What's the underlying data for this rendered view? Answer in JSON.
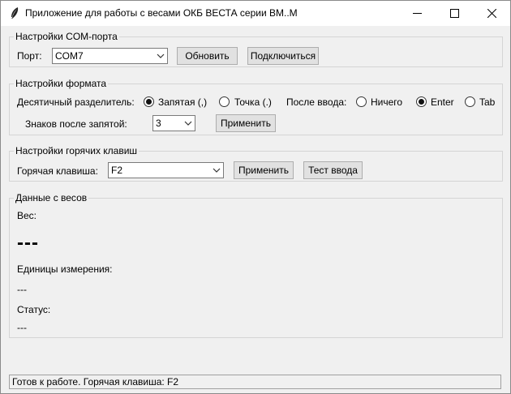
{
  "window": {
    "title": "Приложение для работы с весами ОКБ ВЕСТА серии ВМ..М",
    "icon": "feather-icon"
  },
  "com_settings": {
    "group_title": "Настройки COM-порта",
    "port_label": "Порт:",
    "port_value": "COM7",
    "refresh_label": "Обновить",
    "connect_label": "Подключиться"
  },
  "format_settings": {
    "group_title": "Настройки формата",
    "decimal_label": "Десятичный разделитель:",
    "comma_option": "Запятая (,)",
    "dot_option": "Точка (.)",
    "decimal_selected": "comma",
    "after_input_label": "После ввода:",
    "nothing_option": "Ничего",
    "enter_option": "Enter",
    "tab_option": "Tab",
    "after_input_selected": "enter",
    "digits_label": "Знаков после запятой:",
    "digits_value": "3",
    "apply_label": "Применить"
  },
  "hotkey_settings": {
    "group_title": "Настройки горячих клавиш",
    "hotkey_label": "Горячая клавиша:",
    "hotkey_value": "F2",
    "apply_label": "Применить",
    "test_label": "Тест ввода"
  },
  "scale_data": {
    "group_title": "Данные с весов",
    "weight_label": "Вес:",
    "weight_value": "---",
    "units_label": "Единицы измерения:",
    "units_value": "---",
    "status_label": "Статус:",
    "status_value": "---"
  },
  "statusbar": {
    "text": "Готов к работе. Горячая клавиша: F2"
  }
}
